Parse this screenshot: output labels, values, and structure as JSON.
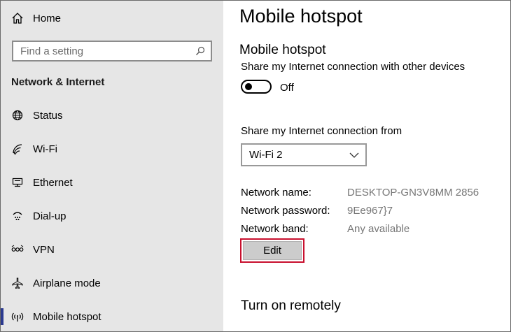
{
  "sidebar": {
    "home_label": "Home",
    "search_placeholder": "Find a setting",
    "section_heading": "Network & Internet",
    "items": [
      {
        "label": "Status",
        "icon": "globe-icon"
      },
      {
        "label": "Wi-Fi",
        "icon": "wifi-icon"
      },
      {
        "label": "Ethernet",
        "icon": "ethernet-icon"
      },
      {
        "label": "Dial-up",
        "icon": "dialup-icon"
      },
      {
        "label": "VPN",
        "icon": "vpn-icon"
      },
      {
        "label": "Airplane mode",
        "icon": "airplane-icon"
      },
      {
        "label": "Mobile hotspot",
        "icon": "hotspot-icon",
        "selected": true
      }
    ]
  },
  "main": {
    "page_title": "Mobile hotspot",
    "section_title": "Mobile hotspot",
    "share_description": "Share my Internet connection with other devices",
    "toggle_state": "Off",
    "share_from_label": "Share my Internet connection from",
    "share_from_value": "Wi-Fi 2",
    "network_name_label": "Network name:",
    "network_name_value": "DESKTOP-GN3V8MM 2856",
    "network_password_label": "Network password:",
    "network_password_value": "9Ee967}7",
    "network_band_label": "Network band:",
    "network_band_value": "Any available",
    "edit_label": "Edit",
    "remote_title": "Turn on remotely"
  },
  "colors": {
    "sidebar_bg": "#e6e6e6",
    "selection_bar": "#2b3a8f",
    "edit_highlight": "#c8102e",
    "secondary_text": "#767676"
  }
}
